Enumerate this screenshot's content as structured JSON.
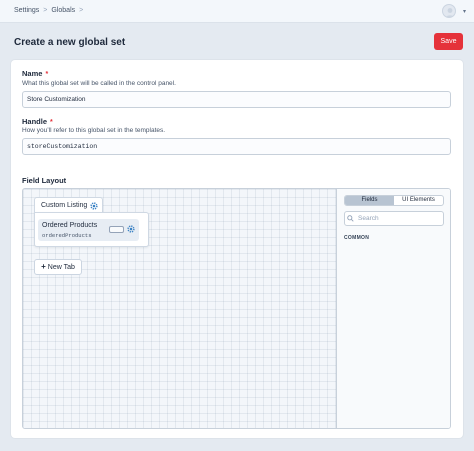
{
  "breadcrumb": {
    "items": [
      "Settings",
      "Globals"
    ],
    "separator": ">"
  },
  "header": {
    "title": "Create a new global set",
    "save_label": "Save"
  },
  "form": {
    "name": {
      "label": "Name",
      "required_mark": "*",
      "help": "What this global set will be called in the control panel.",
      "value": "Store Customization"
    },
    "handle": {
      "label": "Handle",
      "required_mark": "*",
      "help": "How you’ll refer to this global set in the templates.",
      "value": "storeCustomization"
    }
  },
  "field_layout": {
    "label": "Field Layout",
    "tab": {
      "name": "Custom Listing"
    },
    "field": {
      "name": "Ordered Products",
      "handle": "orderedProducts"
    },
    "new_tab_label": "New Tab",
    "new_tab_icon": "+",
    "sidebar": {
      "tabs": [
        {
          "label": "Fields",
          "active": true
        },
        {
          "label": "UI Elements",
          "active": false
        }
      ],
      "search_placeholder": "Search",
      "section_label": "COMMON"
    }
  },
  "colors": {
    "accent": "#e5323a",
    "link_blue": "#3b82c4"
  },
  "icons": {
    "avatar": "user-avatar-icon",
    "settings": "gear-icon",
    "search": "search-icon"
  }
}
